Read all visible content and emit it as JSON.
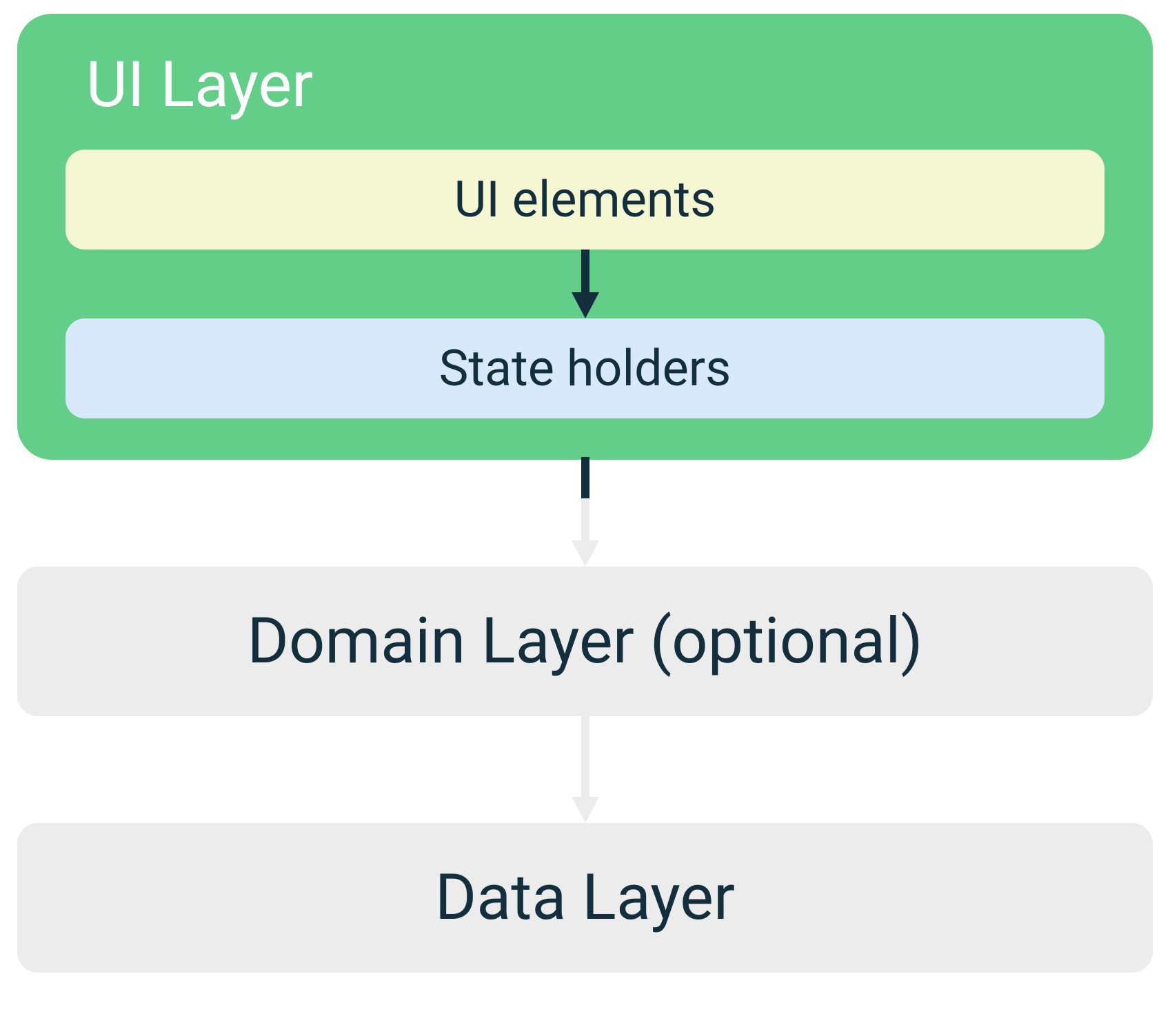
{
  "diagram": {
    "ui_layer": {
      "title": "UI Layer",
      "ui_elements_label": "UI elements",
      "state_holders_label": "State holders"
    },
    "domain_layer_label": "Domain Layer (optional)",
    "data_layer_label": "Data Layer",
    "colors": {
      "ui_layer_bg": "#63ce87",
      "ui_elements_bg": "#f4f7d1",
      "state_holders_bg": "#d7e9fa",
      "layer_box_bg": "#ececec",
      "text_dark": "#132e3d",
      "arrow_dark": "#132e3d",
      "arrow_light": "#ececec"
    }
  }
}
